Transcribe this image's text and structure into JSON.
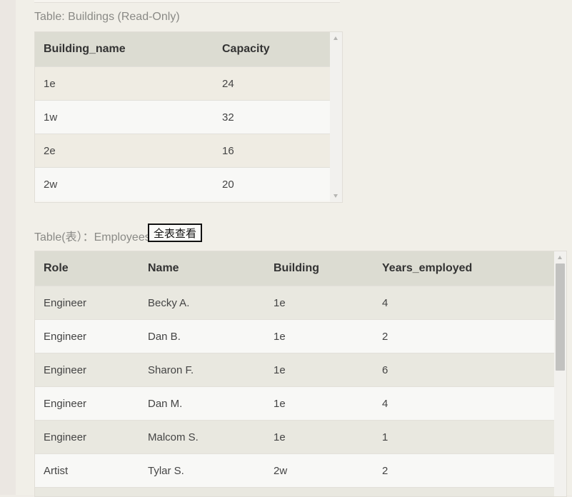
{
  "buildings": {
    "caption": "Table: Buildings (Read-Only)",
    "columns": [
      "Building_name",
      "Capacity"
    ],
    "rows": [
      [
        "1e",
        "24"
      ],
      [
        "1w",
        "32"
      ],
      [
        "2e",
        "16"
      ],
      [
        "2w",
        "20"
      ]
    ]
  },
  "employees": {
    "caption": "Table(表）：Employees",
    "view_all_label": "全表查看",
    "columns": [
      "Role",
      "Name",
      "Building",
      "Years_employed"
    ],
    "rows": [
      [
        "Engineer",
        "Becky A.",
        "1e",
        "4"
      ],
      [
        "Engineer",
        "Dan B.",
        "1e",
        "2"
      ],
      [
        "Engineer",
        "Sharon F.",
        "1e",
        "6"
      ],
      [
        "Engineer",
        "Dan M.",
        "1e",
        "4"
      ],
      [
        "Engineer",
        "Malcom S.",
        "1e",
        "1"
      ],
      [
        "Artist",
        "Tylar S.",
        "2w",
        "2"
      ]
    ]
  }
}
